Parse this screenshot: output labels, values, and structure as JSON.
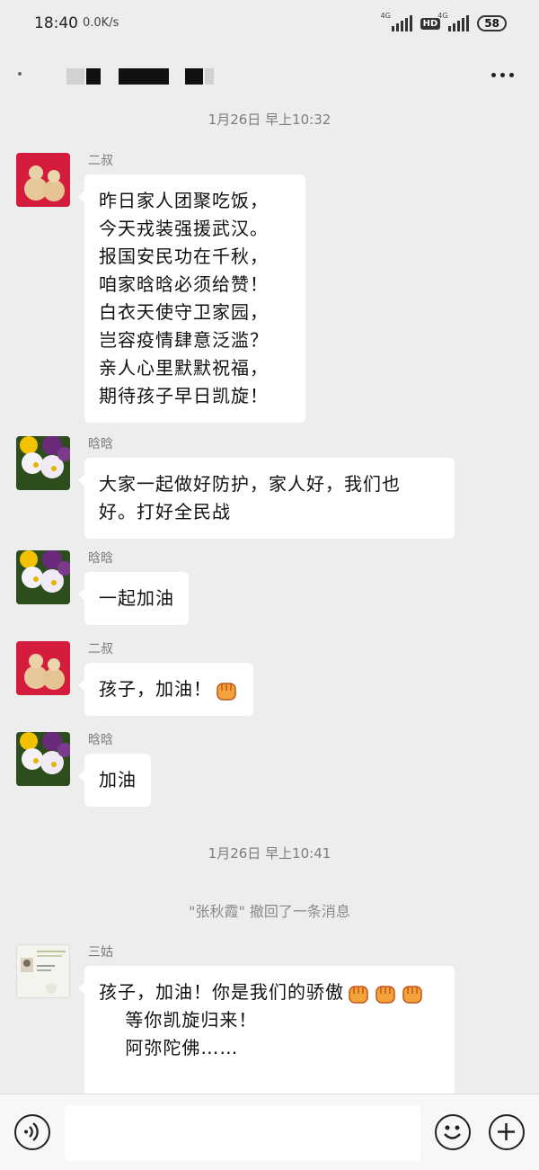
{
  "status_bar": {
    "time": "18:40",
    "speed": "0.0K/s",
    "network1": "4G",
    "network2": "4G",
    "hd": "HD",
    "battery": "58"
  },
  "chat": {
    "timestamp1": "1月26日 早上10:32",
    "timestamp2": "1月26日 早上10:41",
    "recall_notice": "\"张秋霞\" 撤回了一条消息"
  },
  "messages": [
    {
      "sender": "二叔",
      "text": "昨日家人团聚吃饭，\n今天戎装强援武汉。\n报国安民功在千秋，\n咱家晗晗必须给赞！\n白衣天使守卫家园，\n岂容疫情肆意泛滥？\n亲人心里默默祝福，\n期待孩子早日凯旋！"
    },
    {
      "sender": "晗晗",
      "text": "大家一起做好防护，家人好，我们也\n好。打好全民战"
    },
    {
      "sender": "晗晗",
      "text": "一起加油"
    },
    {
      "sender": "二叔",
      "text": "孩子，加油！"
    },
    {
      "sender": "晗晗",
      "text": "加油"
    },
    {
      "sender": "三姑",
      "text": "孩子，加油！你是我们的骄傲",
      "text2": "    等你凯旋归来！\n    阿弥陀佛……"
    }
  ],
  "icons": {
    "voice": "voice-icon",
    "emoji": "emoji-icon",
    "add": "plus-icon",
    "fist": "fist-emoji-icon"
  },
  "colors": {
    "background": "#ededed",
    "bubble": "#ffffff",
    "fist": "#f3a33a"
  }
}
